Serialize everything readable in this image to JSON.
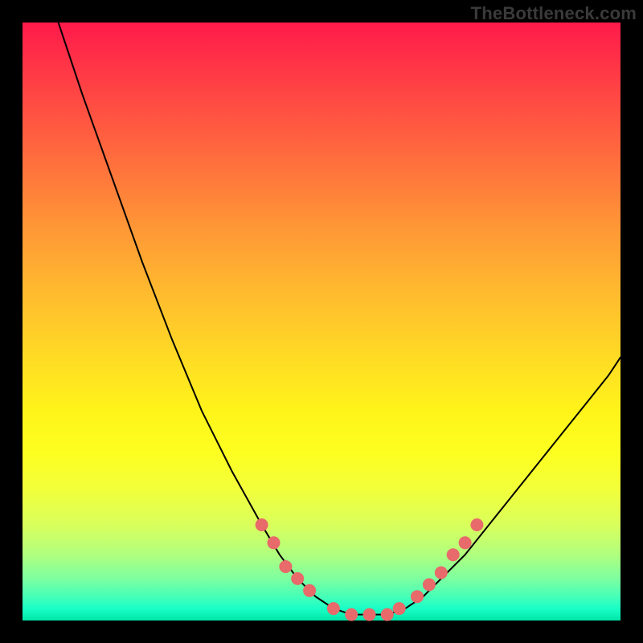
{
  "watermark": "TheBottleneck.com",
  "colors": {
    "curve_stroke": "#000000",
    "dot_fill": "#e86a6a",
    "background_black": "#000000"
  },
  "chart_data": {
    "type": "line",
    "title": "",
    "xlabel": "",
    "ylabel": "",
    "xlim": [
      0,
      100
    ],
    "ylim": [
      0,
      100
    ],
    "note": "Axes have no visible tick labels; x and y expressed as 0-100% of the plot area. y=0 is the bottom (green), y=100 is the top (red). The curve is a V-shaped valley with its flat minimum ~50-64% x at y~0-2, the left arm rising steeply off the top at x~6, the right arm rising to y~45 at x=100.",
    "series": [
      {
        "name": "bottleneck-curve",
        "x": [
          6,
          10,
          15,
          20,
          25,
          30,
          35,
          40,
          43,
          46,
          49,
          52,
          55,
          58,
          61,
          64,
          67,
          70,
          74,
          78,
          82,
          86,
          90,
          94,
          98,
          100
        ],
        "y": [
          100,
          88,
          74,
          60,
          47,
          35,
          25,
          16,
          11,
          7,
          4,
          2,
          1,
          1,
          1,
          2,
          4,
          7,
          11,
          16,
          21,
          26,
          31,
          36,
          41,
          44
        ]
      }
    ],
    "highlight_dots": {
      "name": "salmon-dots",
      "note": "Thick salmon-pink dotted segments overlaid along the curve on both flanks of the valley and across the floor.",
      "points": [
        {
          "x": 40,
          "y": 16
        },
        {
          "x": 42,
          "y": 13
        },
        {
          "x": 44,
          "y": 9
        },
        {
          "x": 46,
          "y": 7
        },
        {
          "x": 48,
          "y": 5
        },
        {
          "x": 52,
          "y": 2
        },
        {
          "x": 55,
          "y": 1
        },
        {
          "x": 58,
          "y": 1
        },
        {
          "x": 61,
          "y": 1
        },
        {
          "x": 63,
          "y": 2
        },
        {
          "x": 66,
          "y": 4
        },
        {
          "x": 68,
          "y": 6
        },
        {
          "x": 70,
          "y": 8
        },
        {
          "x": 72,
          "y": 11
        },
        {
          "x": 74,
          "y": 13
        },
        {
          "x": 76,
          "y": 16
        }
      ]
    }
  }
}
